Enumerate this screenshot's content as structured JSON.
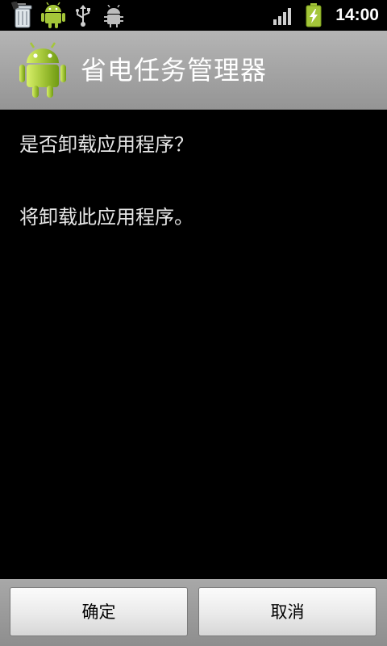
{
  "status_bar": {
    "notification_icons": [
      "trash-icon",
      "android-icon",
      "usb-icon",
      "debug-bug-icon"
    ],
    "signal_icon": "signal-strength-icon",
    "battery_icon": "battery-charging-icon",
    "time": "14:00"
  },
  "title_bar": {
    "app_icon": "android-icon",
    "title": "省电任务管理器"
  },
  "dialog": {
    "question": "是否卸载应用程序？",
    "detail": "将卸载此应用程序。"
  },
  "buttons": {
    "confirm_label": "确定",
    "cancel_label": "取消"
  },
  "colors": {
    "android_green": "#a4c639",
    "title_bar_gray": "#a6a6a6",
    "background": "#000000"
  }
}
